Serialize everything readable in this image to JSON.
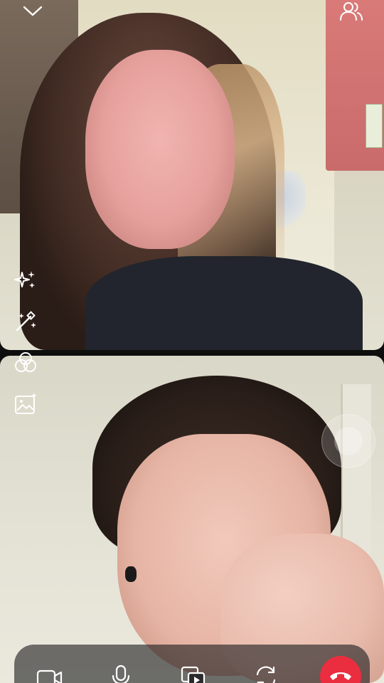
{
  "top_bar": {
    "collapse_icon": "chevron-down-icon",
    "participants_icon": "people-icon"
  },
  "effects": [
    {
      "icon": "sparkles-icon"
    },
    {
      "icon": "magic-wand-icon"
    },
    {
      "icon": "filters-icon"
    },
    {
      "icon": "background-image-icon"
    }
  ],
  "call_controls": [
    {
      "icon": "video-camera-icon"
    },
    {
      "icon": "microphone-icon"
    },
    {
      "icon": "share-media-icon"
    },
    {
      "icon": "flip-camera-icon"
    },
    {
      "icon": "end-call-icon"
    }
  ],
  "colors": {
    "end_call": "#ea2d3f",
    "control_bar": "rgba(30,30,32,0.62)",
    "icon": "#ffffff"
  }
}
